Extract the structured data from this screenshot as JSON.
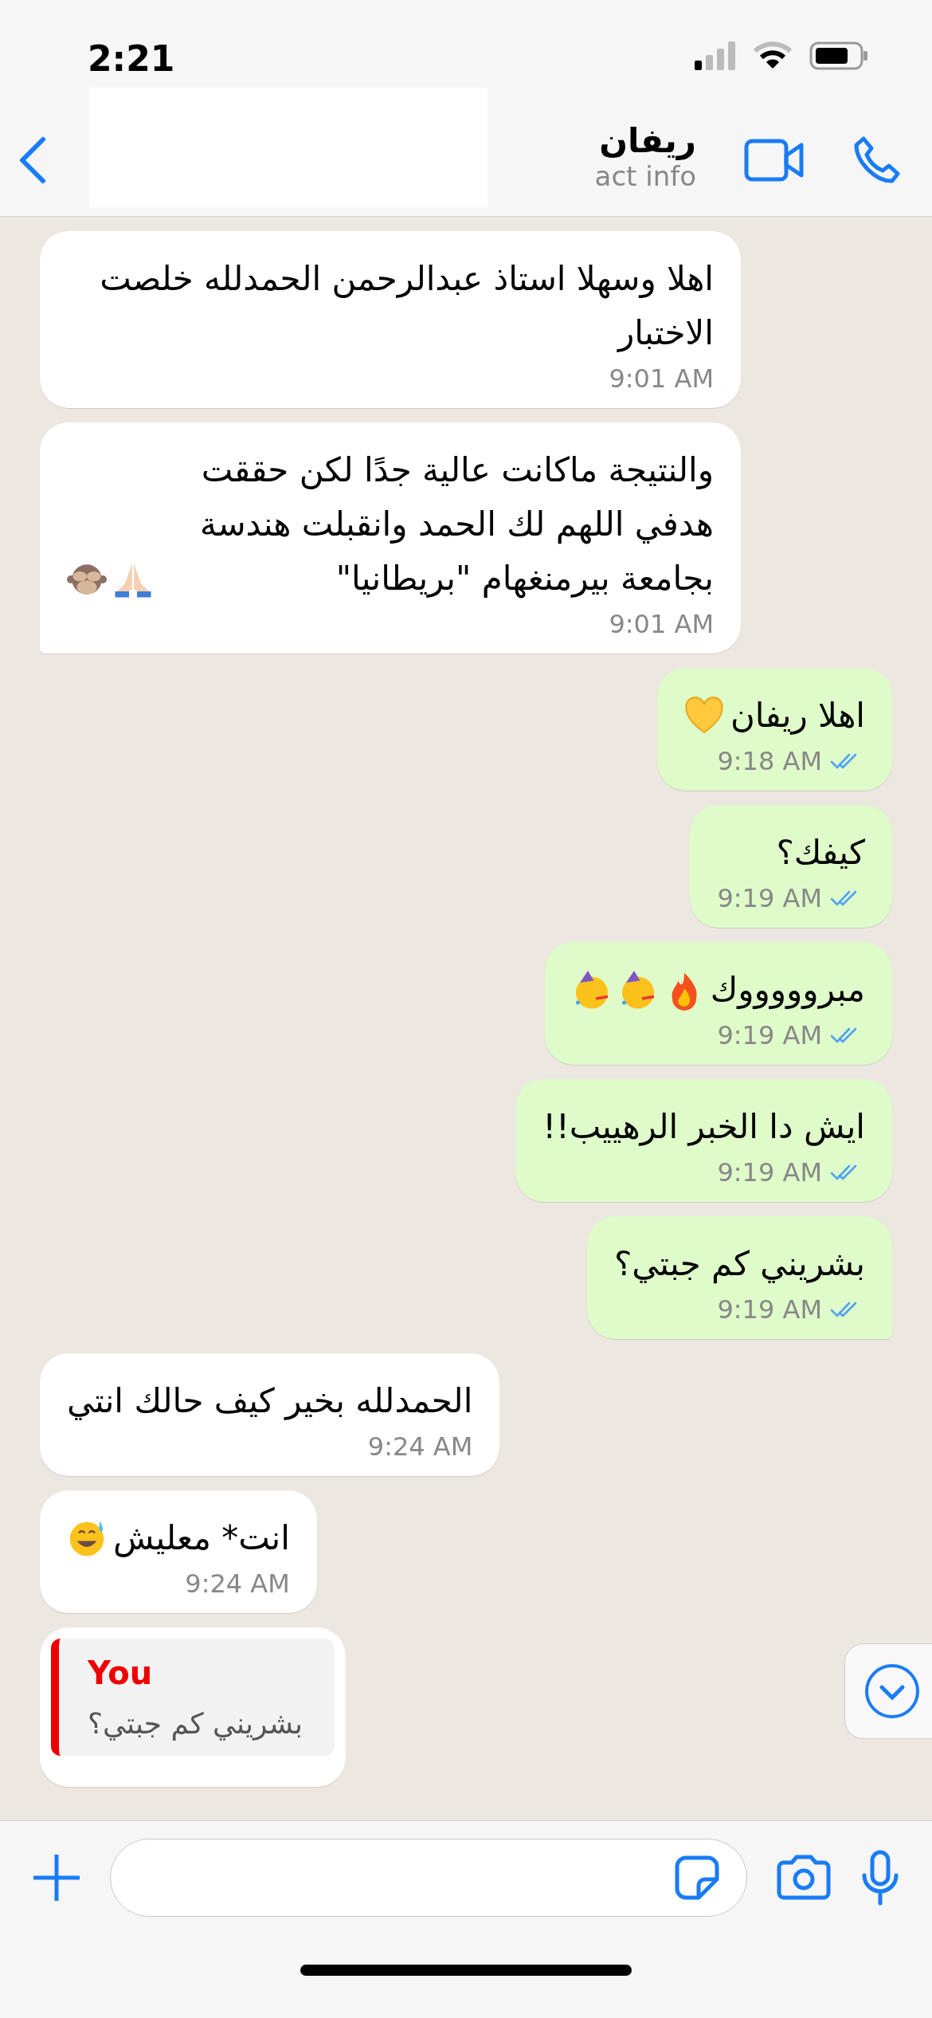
{
  "status_bar": {
    "time": "2:21"
  },
  "header": {
    "name": "ريفان",
    "subtitle": "act info"
  },
  "messages": [
    {
      "kind": "incoming",
      "text": "اهلا وسهلا استاذ عبدالرحمن الحمدلله خلصت الاختبار",
      "time": "9:01 AM"
    },
    {
      "kind": "incoming",
      "text": "والنتيجة ماكانت عالية جدًا لكن حققت هدفي اللهم لك الحمد وانقبلت هندسة بجامعة بيرمنغهام \"بريطانيا\"",
      "emojis": [
        {
          "kind": "pray"
        },
        {
          "kind": "monkey"
        }
      ],
      "time": "9:01 AM"
    },
    {
      "kind": "outgoing",
      "text": "اهلا ريفان",
      "emojis": [
        {
          "kind": "heart"
        }
      ],
      "time": "9:18 AM"
    },
    {
      "kind": "outgoing",
      "text": "كيفك؟",
      "time": "9:19 AM"
    },
    {
      "kind": "outgoing",
      "text": "مبروووووك",
      "emojis": [
        {
          "kind": "fire"
        },
        {
          "kind": "party"
        },
        {
          "kind": "party"
        }
      ],
      "time": "9:19 AM"
    },
    {
      "kind": "outgoing",
      "text": "ايش دا الخبر الرهييب!!",
      "time": "9:19 AM"
    },
    {
      "kind": "outgoing",
      "text": "بشريني كم جبتي؟",
      "time": "9:19 AM"
    },
    {
      "kind": "incoming",
      "text": "الحمدلله بخير كيف حالك انتي",
      "time": "9:24 AM"
    },
    {
      "kind": "incoming",
      "text": "انت* معليش",
      "emojis": [
        {
          "kind": "sweat"
        }
      ],
      "time": "9:24 AM"
    },
    {
      "kind": "incoming",
      "quote": {
        "author": "You",
        "text": "بشريني كم جبتي؟"
      }
    }
  ]
}
